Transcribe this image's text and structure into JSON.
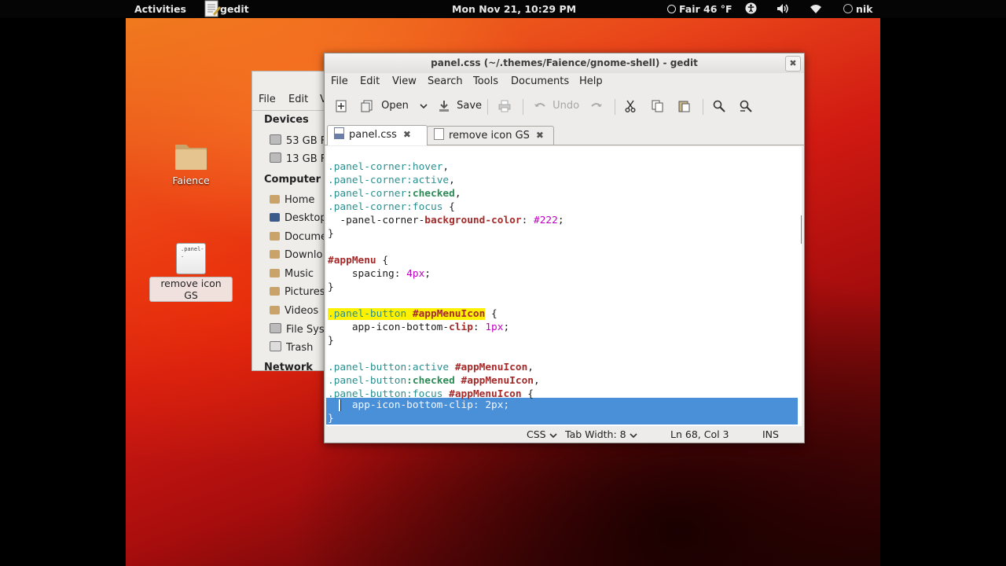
{
  "topbar": {
    "activities": "Activities",
    "app_name": "gedit",
    "clock": "Mon Nov 21, 10:29 PM",
    "weather": "Fair 46 °F",
    "user": "nik"
  },
  "desktop": {
    "icons": [
      {
        "label": "Faience"
      },
      {
        "label": "remove icon GS",
        "thumb_text": ".panel-"
      }
    ]
  },
  "nautilus": {
    "menu": [
      "File",
      "Edit",
      "V"
    ],
    "sections": {
      "devices": "Devices",
      "computer": "Computer",
      "network": "Network"
    },
    "devices": [
      "53 GB Fi",
      "13 GB Fi"
    ],
    "places": [
      "Home",
      "Desktop",
      "Docume",
      "Downlo",
      "Music",
      "Pictures",
      "Videos",
      "File Syst",
      "Trash"
    ]
  },
  "gedit": {
    "title": "panel.css (~/.themes/Faience/gnome-shell) - gedit",
    "menu": [
      "File",
      "Edit",
      "View",
      "Search",
      "Tools",
      "Documents",
      "Help"
    ],
    "toolbar": {
      "open": "Open",
      "save": "Save",
      "undo": "Undo"
    },
    "tabs": [
      "panel.css",
      "remove icon GS"
    ],
    "status": {
      "language": "CSS",
      "tab_width": "Tab Width: 8",
      "position": "Ln 68, Col 3",
      "mode": "INS"
    }
  },
  "code": {
    "l1": {
      "a": ".panel-corner",
      "b": ":hover",
      "c": ","
    },
    "l2": {
      "a": ".panel-corner",
      "b": ":active",
      "c": ","
    },
    "l3": {
      "a": ".panel-corner",
      "b": ":checked",
      "c": ","
    },
    "l4": {
      "a": ".panel-corner",
      "b": ":focus",
      "c": " {"
    },
    "l5": {
      "a": "  -panel-corner-",
      "b": "background-color",
      "c": ": ",
      "d": "#222",
      "e": ";"
    },
    "l6": "}",
    "l8": {
      "a": "#appMenu",
      "b": " {"
    },
    "l9": {
      "a": "    spacing: ",
      "b": "4px",
      "c": ";"
    },
    "l10": "}",
    "l12": {
      "a": ".panel-button ",
      "b": "#appMenuIcon",
      "c": " {"
    },
    "l13": {
      "a": "    app-icon-bottom-",
      "b": "clip",
      "c": ": ",
      "d": "1px",
      "e": ";"
    },
    "l14": "}",
    "l16": {
      "a": ".panel-button",
      "b": ":active",
      "c": " ",
      "d": "#appMenuIcon",
      "e": ","
    },
    "l17": {
      "a": ".panel-button",
      "b": ":checked",
      "c": " ",
      "d": "#appMenuIcon",
      "e": ","
    },
    "l18": {
      "a": ".panel-button",
      "b": ":focus",
      "c": " ",
      "d": "#appMenuIcon",
      "e": " {"
    },
    "l19": "    app-icon-bottom-clip: 2px;",
    "l20": "}"
  }
}
